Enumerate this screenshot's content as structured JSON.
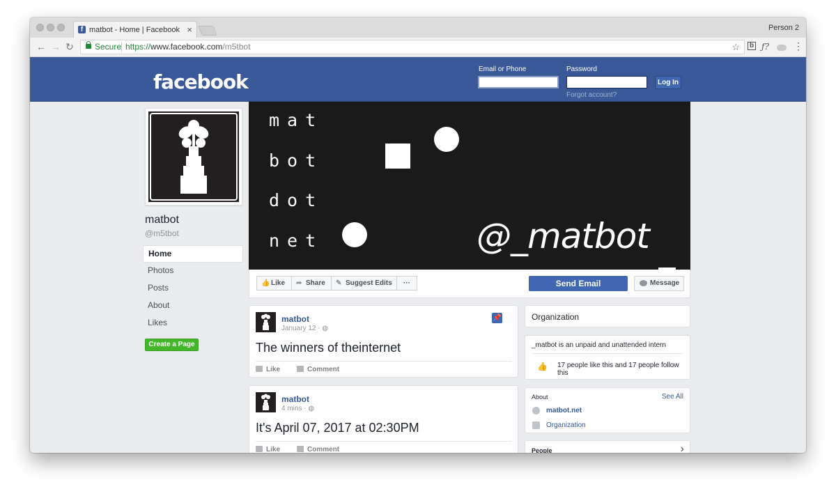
{
  "browser": {
    "tab_title": "matbot - Home | Facebook",
    "tab_close": "×",
    "favicon": "f",
    "profile_name": "Person 2",
    "secure_label": "Secure",
    "url_scheme": "https://",
    "url_host": "www.facebook.com",
    "url_path": "/m5tbot",
    "nav": {
      "back": "←",
      "forward": "→",
      "reload": "↻"
    },
    "star": "☆",
    "ext1": "b",
    "ext2": "ƒ?",
    "menu": "⋮"
  },
  "fb_header": {
    "logo": "facebook",
    "email_label": "Email or Phone",
    "password_label": "Password",
    "login_button": "Log In",
    "forgot": "Forgot account?"
  },
  "page": {
    "name": "matbot",
    "handle": "@m5tbot",
    "nav": [
      {
        "label": "Home",
        "active": true
      },
      {
        "label": "Photos"
      },
      {
        "label": "Posts"
      },
      {
        "label": "About"
      },
      {
        "label": "Likes"
      }
    ],
    "create_page": "Create a Page"
  },
  "cover": {
    "words": [
      "mat",
      "bot",
      "dot",
      "net"
    ],
    "handle": "@_matbot"
  },
  "actions": {
    "like": "Like",
    "share": "Share",
    "suggest": "Suggest Edits",
    "more": "···",
    "send_email": "Send Email",
    "message": "Message"
  },
  "posts": [
    {
      "author": "matbot",
      "date": "January 12 · ",
      "text": "The winners of theinternet",
      "like": "Like",
      "comment": "Comment",
      "pinned": true
    },
    {
      "author": "matbot",
      "date": "4 mins · ",
      "text": "It's April 07, 2017 at 02:30PM",
      "like": "Like",
      "comment": "Comment",
      "pinned": false
    }
  ],
  "sidebar": {
    "category": "Organization",
    "description": "_matbot is an unpaid and unattended intern",
    "likes_follows": "17 people like this and 17 people follow this",
    "about_title": "About",
    "see_all": "See All",
    "website": "matbot.net",
    "org_link": "Organization",
    "people_title": "People",
    "people_chevron": "›"
  },
  "colors": {
    "fb_blue": "#3b5998",
    "button_blue": "#4267b2",
    "green": "#42b72a",
    "link": "#365899"
  }
}
